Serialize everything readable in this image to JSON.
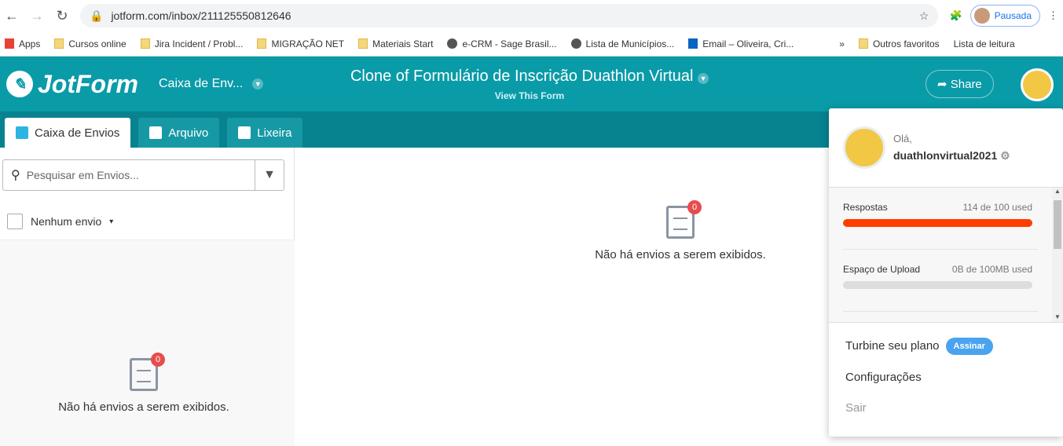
{
  "browser": {
    "url": "jotform.com/inbox/211125550812646",
    "profile": "Pausada",
    "bookmarks": [
      "Apps",
      "Cursos online",
      "Jira Incident / Probl...",
      "MIGRAÇÃO NET",
      "Materiais Start",
      "e-CRM - Sage Brasil...",
      "Lista de Municípios...",
      "Email – Oliveira, Cri...",
      "»",
      "Outros favoritos",
      "Lista de leitura"
    ]
  },
  "header": {
    "logo": "JotForm",
    "inbox_selector": "Caixa de Env...",
    "form_title": "Clone of Formulário de Inscrição Duathlon Virtual",
    "view_form": "View This Form",
    "share": "Share"
  },
  "tabs": [
    {
      "label": "Caixa de Envios"
    },
    {
      "label": "Arquivo"
    },
    {
      "label": "Lixeira"
    }
  ],
  "left": {
    "search_placeholder": "Pesquisar em Envios...",
    "select_label": "Nenhum envio",
    "empty_text": "Não há envios a serem exibidos.",
    "badge": "0"
  },
  "main": {
    "empty_text": "Não há envios a serem exibidos.",
    "badge": "0"
  },
  "account": {
    "greeting": "Olá,",
    "username": "duathlonvirtual2021",
    "usage": [
      {
        "label": "Respostas",
        "value": "114 de 100 used",
        "percent": 100,
        "color": "#ff3d00"
      },
      {
        "label": "Espaço de Upload",
        "value": "0B de 100MB used",
        "percent": 0
      }
    ],
    "upgrade": "Turbine seu plano",
    "subscribe": "Assinar",
    "settings": "Configurações",
    "logout": "Sair"
  }
}
